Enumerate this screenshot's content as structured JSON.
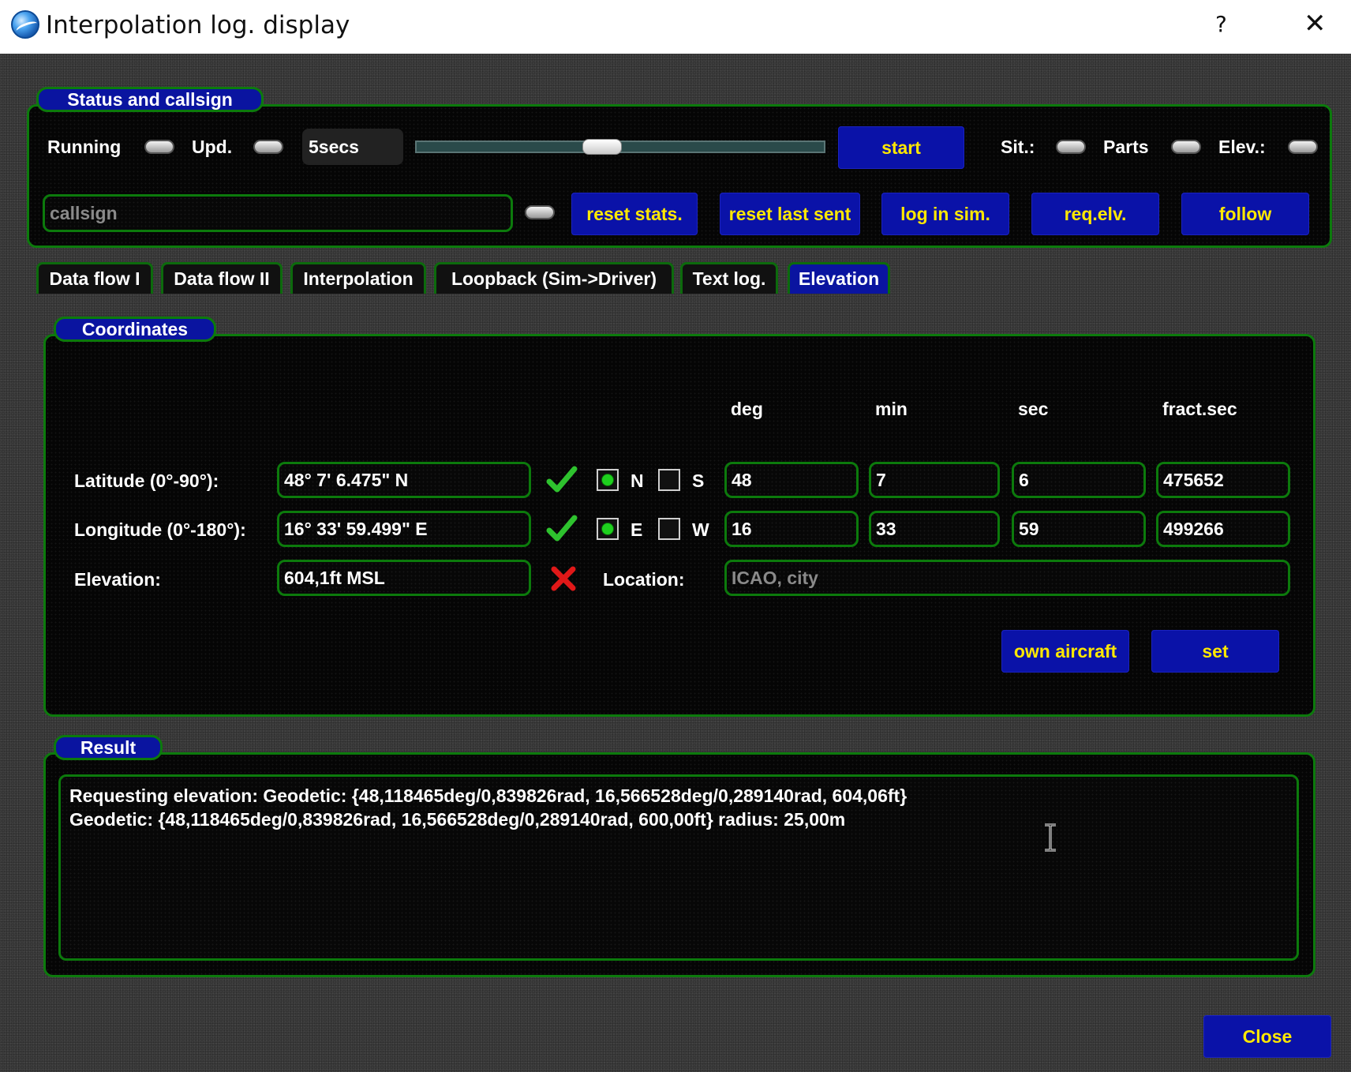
{
  "window": {
    "title": "Interpolation log. display",
    "help": "?",
    "close": "✕"
  },
  "status": {
    "title": "Status and callsign",
    "running_label": "Running",
    "upd_label": "Upd.",
    "interval": "5secs",
    "slider_value_fraction": 0.45,
    "start_label": "start",
    "sit_label": "Sit.:",
    "parts_label": "Parts",
    "elev_label": "Elev.:",
    "callsign_placeholder": "callsign",
    "buttons": {
      "reset_stats": "reset stats.",
      "reset_last_sent": "reset last sent",
      "log_in_sim": "log in sim.",
      "req_elv": "req.elv.",
      "follow": "follow"
    }
  },
  "tabs": [
    {
      "label": "Data flow I",
      "active": false
    },
    {
      "label": "Data flow II",
      "active": false
    },
    {
      "label": "Interpolation",
      "active": false
    },
    {
      "label": "Loopback (Sim->Driver)",
      "active": false
    },
    {
      "label": "Text log.",
      "active": false
    },
    {
      "label": "Elevation",
      "active": true
    }
  ],
  "coordinates": {
    "title": "Coordinates",
    "headers": {
      "deg": "deg",
      "min": "min",
      "sec": "sec",
      "fract": "fract.sec"
    },
    "latitude": {
      "label": "Latitude (0°-90°):",
      "value": "48° 7' 6.475\" N",
      "radio1": "N",
      "radio2": "S",
      "deg": "48",
      "min": "7",
      "sec": "6",
      "fract": "475652"
    },
    "longitude": {
      "label": "Longitude (0°-180°):",
      "value": "16° 33' 59.499\" E",
      "radio1": "E",
      "radio2": "W",
      "deg": "16",
      "min": "33",
      "sec": "59",
      "fract": "499266"
    },
    "elevation": {
      "label": "Elevation:",
      "value": "604,1ft MSL"
    },
    "location": {
      "label": "Location:",
      "placeholder": "ICAO, city"
    },
    "own_aircraft": "own aircraft",
    "set": "set"
  },
  "result": {
    "title": "Result",
    "line1": "Requesting elevation: Geodetic: {48,118465deg/0,839826rad, 16,566528deg/0,289140rad, 604,06ft}",
    "line2": "Geodetic: {48,118465deg/0,839826rad, 16,566528deg/0,289140rad, 600,00ft} radius: 25,00m"
  },
  "close_button": "Close",
  "colors": {
    "panel_border": "#0c7a0c",
    "button_bg": "#0a12a8",
    "button_text": "#ffe800",
    "tab_active": "#0a14a0"
  }
}
